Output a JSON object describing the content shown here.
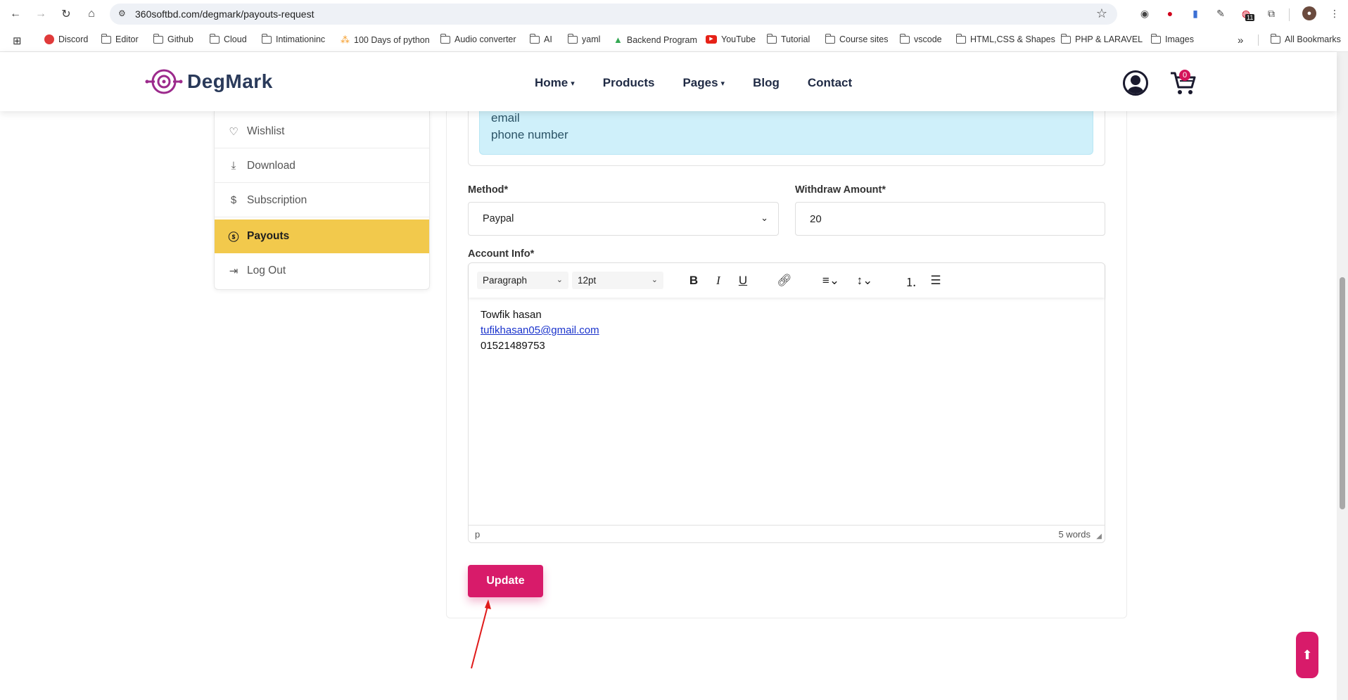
{
  "browser": {
    "url": "360softbd.com/degmark/payouts-request",
    "bookmarks": [
      {
        "label": "Discord",
        "icon": "discord-icon",
        "color": "#e03a3a"
      },
      {
        "label": "Editor",
        "icon": "folder-icon"
      },
      {
        "label": "Github",
        "icon": "folder-icon"
      },
      {
        "label": "Cloud",
        "icon": "folder-icon"
      },
      {
        "label": "Intimationinc",
        "icon": "folder-icon"
      },
      {
        "label": "100 Days of python",
        "icon": "python-icon",
        "color": "#f59a23"
      },
      {
        "label": "Audio converter",
        "icon": "folder-icon"
      },
      {
        "label": "AI",
        "icon": "folder-icon"
      },
      {
        "label": "yaml",
        "icon": "folder-icon"
      },
      {
        "label": "Backend Program",
        "icon": "drive-icon",
        "color": "#34a853"
      },
      {
        "label": "YouTube",
        "icon": "youtube-icon",
        "color": "#e62117"
      },
      {
        "label": "Tutorial",
        "icon": "folder-icon"
      },
      {
        "label": "Course sites",
        "icon": "folder-icon"
      },
      {
        "label": "vscode",
        "icon": "folder-icon"
      },
      {
        "label": "HTML,CSS & Shapes",
        "icon": "folder-icon"
      },
      {
        "label": "PHP & LARAVEL",
        "icon": "folder-icon"
      },
      {
        "label": "Images",
        "icon": "folder-icon"
      }
    ],
    "all_bookmarks": "All Bookmarks",
    "more_chevron": "»",
    "extension_badge": "11"
  },
  "header": {
    "brand": "DegMark",
    "nav": [
      {
        "label": "Home",
        "has_caret": true
      },
      {
        "label": "Products",
        "has_caret": false
      },
      {
        "label": "Pages",
        "has_caret": true
      },
      {
        "label": "Blog",
        "has_caret": false
      },
      {
        "label": "Contact",
        "has_caret": false
      }
    ],
    "cart_count": "0",
    "brand_color": "#9c2a8c"
  },
  "sidebar": {
    "items": [
      {
        "label": "Wishlist",
        "icon": "heart-icon",
        "active": false
      },
      {
        "label": "Download",
        "icon": "download-icon",
        "active": false
      },
      {
        "label": "Subscription",
        "icon": "dollar-icon",
        "active": false
      },
      {
        "label": "Payouts",
        "icon": "coin-icon",
        "active": true
      },
      {
        "label": "Log Out",
        "icon": "logout-icon",
        "active": false
      }
    ],
    "active_color": "#f2c94c"
  },
  "form": {
    "note_lines": [
      "email",
      "phone number"
    ],
    "method_label": "Method*",
    "method_value": "Paypal",
    "amount_label": "Withdraw Amount*",
    "amount_value": "20",
    "account_label": "Account Info*",
    "editor": {
      "block_format": "Paragraph",
      "font_size": "12pt",
      "content_name": "Towfik hasan",
      "content_email": "tufikhasan05@gmail.com",
      "content_phone": "01521489753",
      "status_path": "p",
      "word_count": "5 words"
    },
    "submit_label": "Update",
    "accent_color": "#d81b6a"
  }
}
